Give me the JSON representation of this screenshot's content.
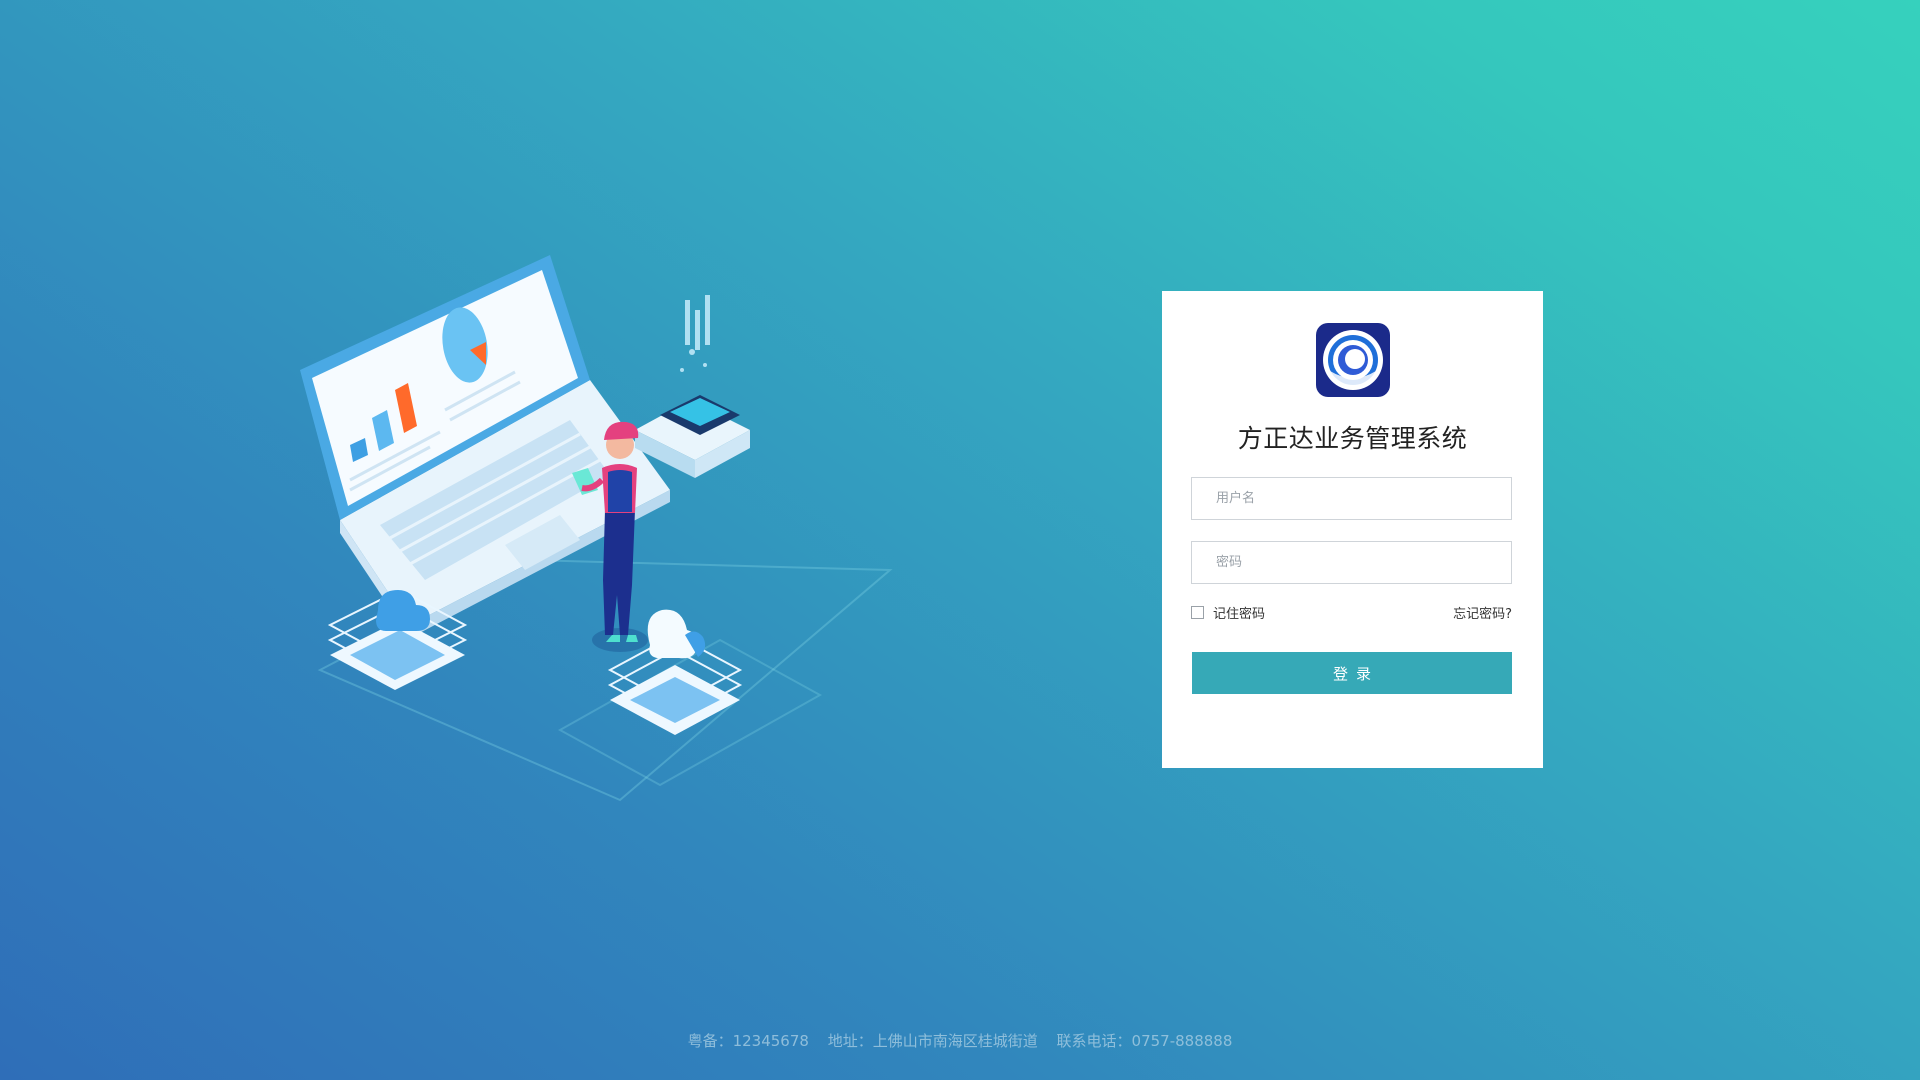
{
  "login": {
    "title": "方正达业务管理系统",
    "username_placeholder": "用户名",
    "username_value": "",
    "password_placeholder": "密码",
    "password_value": "",
    "remember_label": "记住密码",
    "remember_checked": false,
    "forgot_label": "忘记密码?",
    "submit_label": "登录"
  },
  "footer": {
    "icp": "粤备：12345678",
    "address": "地址：上佛山市南海区桂城街道",
    "phone": "联系电话：0757-888888"
  },
  "colors": {
    "button": "#36a9b7",
    "background_start": "#2f6eb8",
    "background_end": "#36d1bd"
  },
  "icons": {
    "logo": "company-logo-icon",
    "illustration": "laptop-analytics-illustration"
  }
}
